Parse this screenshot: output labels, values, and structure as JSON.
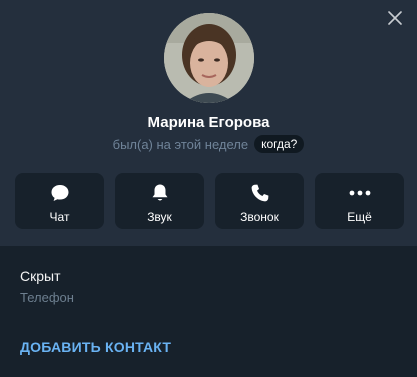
{
  "profile": {
    "name": "Марина Егорова",
    "status": "был(а) на этой неделе",
    "when_label": "когда?"
  },
  "actions": [
    {
      "icon": "chat-bubble-icon",
      "label": "Чат"
    },
    {
      "icon": "bell-icon",
      "label": "Звук"
    },
    {
      "icon": "phone-icon",
      "label": "Звонок"
    },
    {
      "icon": "more-dots-icon",
      "label": "Ещё"
    }
  ],
  "info": {
    "value": "Скрыт",
    "label": "Телефон"
  },
  "add_contact_label": "ДОБАВИТЬ КОНТАКТ",
  "colors": {
    "panel": "#242f3d",
    "background": "#17212b",
    "accent": "#6ab3f3",
    "muted": "#708499"
  }
}
